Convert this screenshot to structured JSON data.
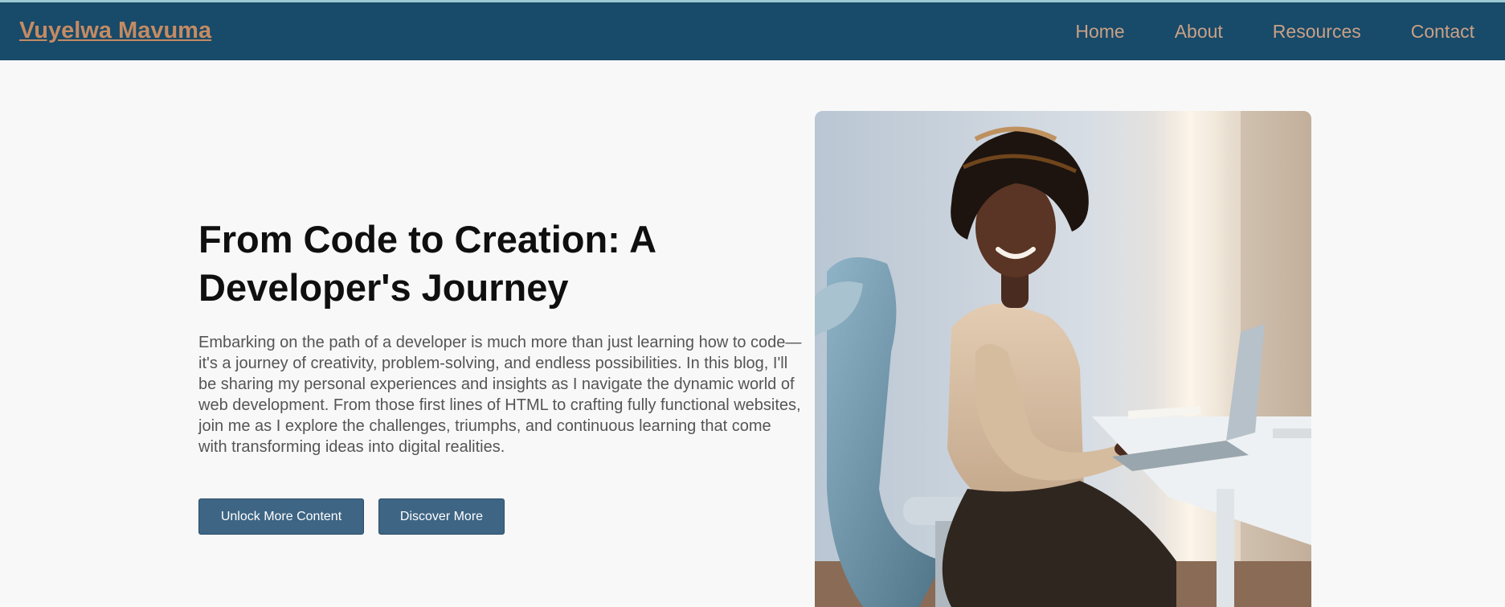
{
  "site": {
    "brand": "Vuyelwa Mavuma"
  },
  "nav": {
    "items": [
      {
        "label": "Home"
      },
      {
        "label": "About"
      },
      {
        "label": "Resources"
      },
      {
        "label": "Contact"
      }
    ]
  },
  "hero": {
    "title": "From Code to Creation: A Developer's Journey",
    "text": "Embarking on the path of a developer is much more than just learning how to code— it's a journey of creativity, problem-solving, and endless possibilities. In this blog, I'll be sharing my personal experiences and insights as I navigate the dynamic world of web development. From those first lines of HTML to crafting fully functional websites, join me as I explore the challenges, triumphs, and continuous learning that come with transforming ideas into digital realities.",
    "buttons": {
      "unlock": "Unlock More Content",
      "discover": "Discover More"
    }
  },
  "colors": {
    "navbar": "#184a69",
    "brand": "#c48b63",
    "nav_link": "#c9a186",
    "button": "#3e6584",
    "background": "#f8f8f8"
  }
}
